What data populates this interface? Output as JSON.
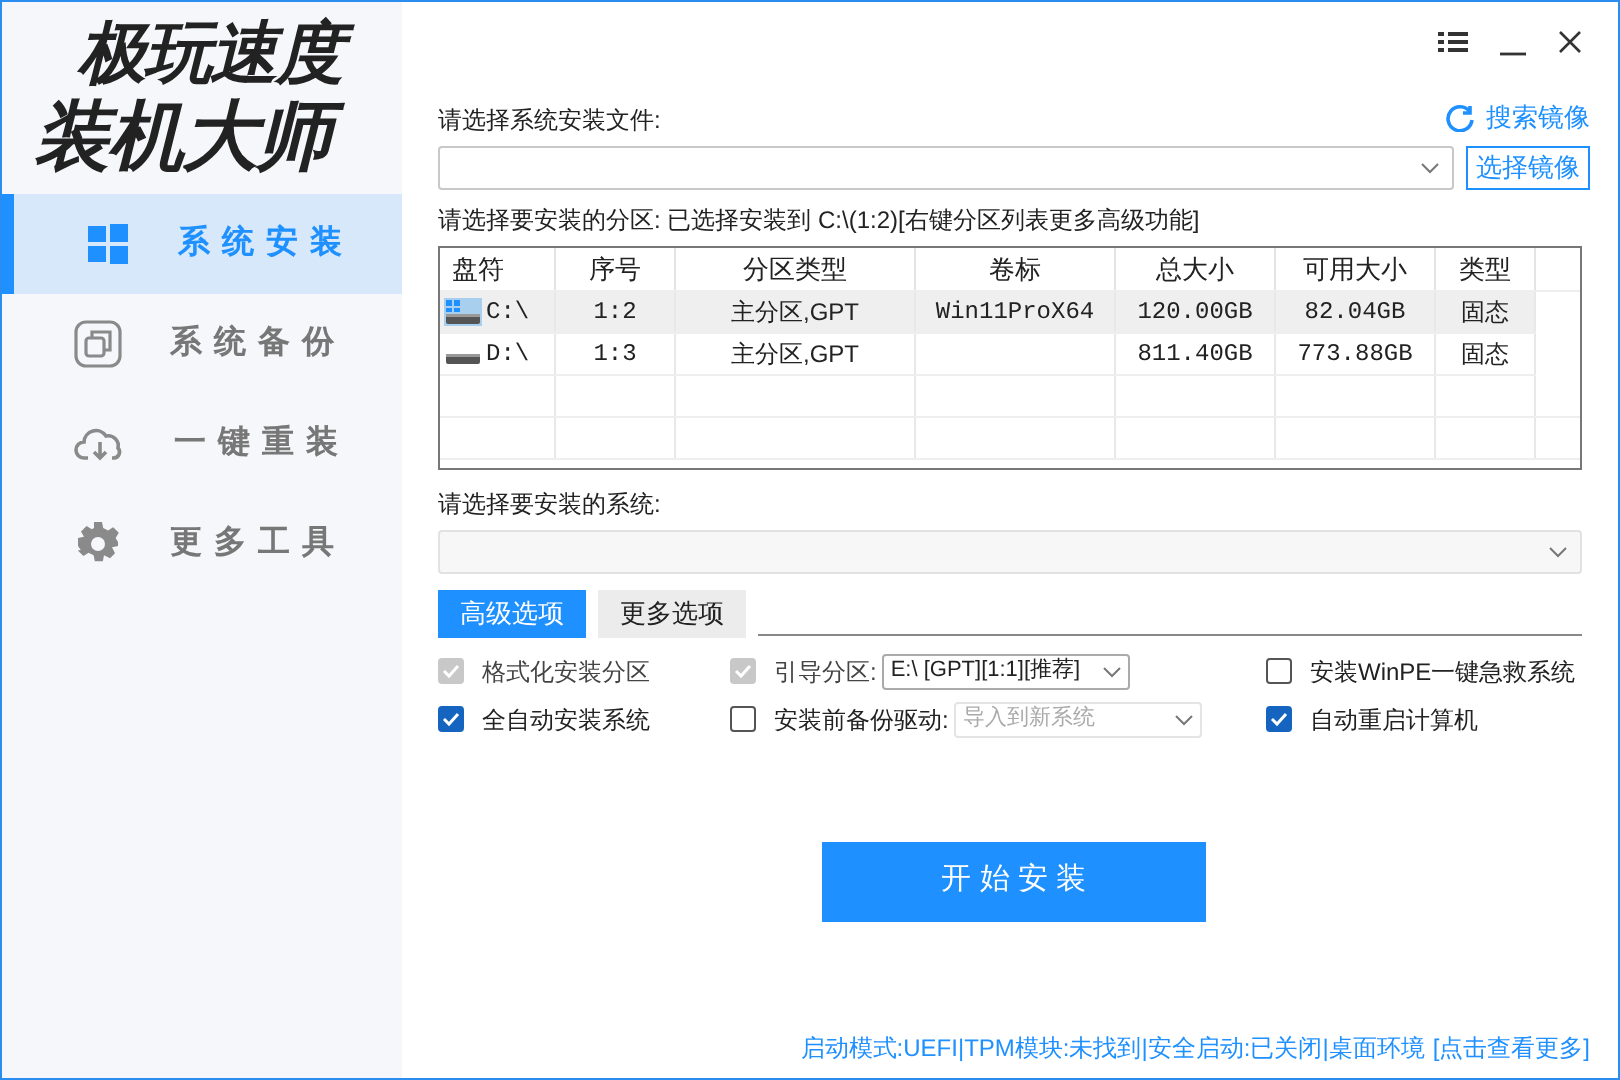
{
  "logo": {
    "line1": "极玩速度",
    "line2": "装机大师"
  },
  "nav": [
    {
      "kind": "windows",
      "label": "系统安装",
      "selected": true
    },
    {
      "kind": "backup",
      "label": "系统备份",
      "selected": false
    },
    {
      "kind": "cloud",
      "label": "一键重装",
      "selected": false
    },
    {
      "kind": "tools",
      "label": "更多工具",
      "selected": false
    }
  ],
  "file": {
    "label": "请选择系统安装文件:",
    "search_link": "搜索镜像",
    "button": "选择镜像"
  },
  "partition_label": "请选择要安装的分区: 已选择安装到 C:\\(1:2)[右键分区列表更多高级功能]",
  "table": {
    "columns": [
      "盘符",
      "序号",
      "分区类型",
      "卷标",
      "总大小",
      "可用大小",
      "类型"
    ],
    "rows": [
      {
        "selected": true,
        "system": true,
        "cells": [
          "C:\\",
          "1:2",
          "主分区,GPT",
          "Win11ProX64",
          "120.00GB",
          "82.04GB",
          "固态"
        ]
      },
      {
        "selected": false,
        "system": false,
        "cells": [
          "D:\\",
          "1:3",
          "主分区,GPT",
          "",
          "811.40GB",
          "773.88GB",
          "固态"
        ]
      }
    ]
  },
  "system_label": "请选择要安装的系统:",
  "tabs": [
    {
      "label": "高级选项",
      "selected": true
    },
    {
      "label": "更多选项",
      "selected": false
    }
  ],
  "options": [
    {
      "kind": "checkbox",
      "label": "格式化安装分区",
      "checked": true,
      "disabled": true
    },
    {
      "kind": "select",
      "label": "引导分区:",
      "checked": true,
      "disabled": true,
      "value": "E:\\ [GPT][1:1][推荐]",
      "select_disabled": false
    },
    {
      "kind": "checkbox",
      "label": "安装WinPE一键急救系统",
      "checked": false,
      "disabled": false
    },
    {
      "kind": "checkbox",
      "label": "全自动安装系统",
      "checked": true,
      "disabled": false
    },
    {
      "kind": "select",
      "label": "安装前备份驱动:",
      "checked": false,
      "disabled": false,
      "value": "导入到新系统",
      "select_disabled": true
    },
    {
      "kind": "checkbox",
      "label": "自动重启计算机",
      "checked": true,
      "disabled": false
    }
  ],
  "start_button": "开 始 安 装",
  "status": {
    "text": "启动模式:UEFI|TPM模块:未找到|安全启动:已关闭|桌面环境",
    "link": "[点击查看更多]"
  }
}
